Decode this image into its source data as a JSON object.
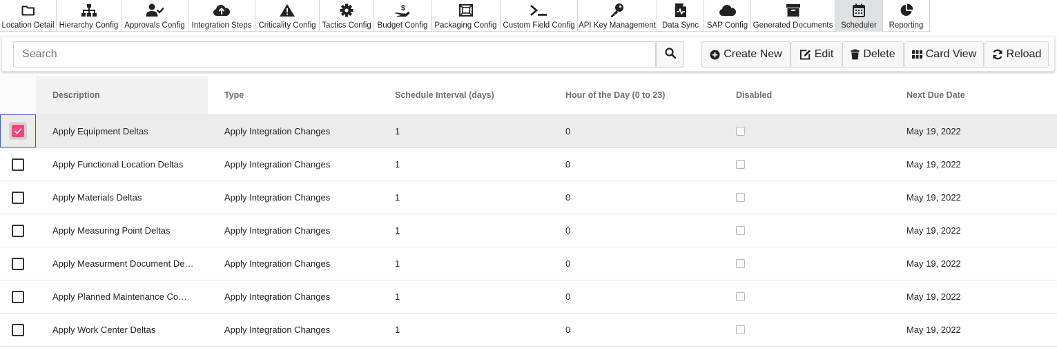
{
  "nav": {
    "items": [
      {
        "label": "Location Detail",
        "icon": "folder-icon"
      },
      {
        "label": "Hierarchy Config",
        "icon": "sitemap-icon"
      },
      {
        "label": "Approvals Config",
        "icon": "user-check-icon"
      },
      {
        "label": "Integration Steps",
        "icon": "cloud-upload-icon"
      },
      {
        "label": "Criticality Config",
        "icon": "warning-icon"
      },
      {
        "label": "Tactics Config",
        "icon": "gear-icon"
      },
      {
        "label": "Budget Config",
        "icon": "hand-dollar-icon"
      },
      {
        "label": "Packaging Config",
        "icon": "package-icon"
      },
      {
        "label": "Custom Field Config",
        "icon": "terminal-icon"
      },
      {
        "label": "API Key Management",
        "icon": "key-icon"
      },
      {
        "label": "Data Sync",
        "icon": "file-sync-icon"
      },
      {
        "label": "SAP Config",
        "icon": "cloud-icon"
      },
      {
        "label": "Generated Documents",
        "icon": "archive-icon"
      },
      {
        "label": "Scheduler",
        "icon": "calendar-icon"
      },
      {
        "label": "Reporting",
        "icon": "pie-chart-icon"
      }
    ],
    "active": "Scheduler"
  },
  "toolbar": {
    "search_placeholder": "Search",
    "search_value": "",
    "create_label": "Create New",
    "edit_label": "Edit",
    "delete_label": "Delete",
    "card_view_label": "Card View",
    "reload_label": "Reload"
  },
  "table": {
    "columns": [
      "Description",
      "Type",
      "Schedule Interval (days)",
      "Hour of the Day (0 to 23)",
      "Disabled",
      "Next Due Date"
    ],
    "rows": [
      {
        "description": "Apply Equipment Deltas",
        "type": "Apply Integration Changes",
        "interval": "1",
        "hour": "0",
        "disabled": false,
        "next_due": "May 19, 2022",
        "selected": true
      },
      {
        "description": "Apply Functional Location Deltas",
        "type": "Apply Integration Changes",
        "interval": "1",
        "hour": "0",
        "disabled": false,
        "next_due": "May 19, 2022",
        "selected": false
      },
      {
        "description": "Apply Materials Deltas",
        "type": "Apply Integration Changes",
        "interval": "1",
        "hour": "0",
        "disabled": false,
        "next_due": "May 19, 2022",
        "selected": false
      },
      {
        "description": "Apply Measuring Point Deltas",
        "type": "Apply Integration Changes",
        "interval": "1",
        "hour": "0",
        "disabled": false,
        "next_due": "May 19, 2022",
        "selected": false
      },
      {
        "description": "Apply Measurment Document De…",
        "type": "Apply Integration Changes",
        "interval": "1",
        "hour": "0",
        "disabled": false,
        "next_due": "May 19, 2022",
        "selected": false
      },
      {
        "description": "Apply Planned Maintenance Com…",
        "type": "Apply Integration Changes",
        "interval": "1",
        "hour": "0",
        "disabled": false,
        "next_due": "May 19, 2022",
        "selected": false
      },
      {
        "description": "Apply Work Center Deltas",
        "type": "Apply Integration Changes",
        "interval": "1",
        "hour": "0",
        "disabled": false,
        "next_due": "May 19, 2022",
        "selected": false
      }
    ]
  },
  "colors": {
    "checkbox_checked": "#ff4081",
    "active_tab": "#dfe1e3",
    "selected_row": "#ececec"
  }
}
